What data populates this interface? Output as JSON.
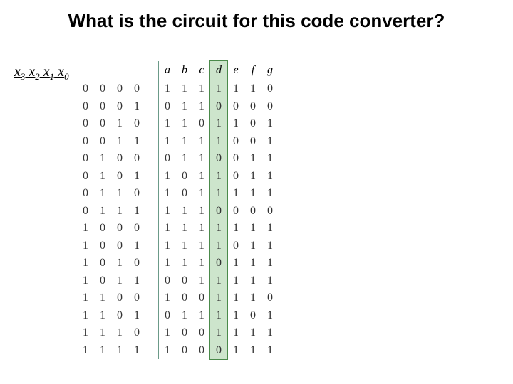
{
  "title": "What is the circuit for this code converter?",
  "input_vars": [
    "x",
    "3",
    "x",
    "2",
    "x",
    "1",
    "x",
    "0"
  ],
  "headers": {
    "inputs": [
      "",
      "",
      "",
      ""
    ],
    "outputs": [
      "a",
      "b",
      "c",
      "d",
      "e",
      "f",
      "g"
    ]
  },
  "highlight_column": "d",
  "chart_data": {
    "type": "table",
    "title": "4-bit input to 7-segment (a–g) code converter truth table",
    "input_labels": [
      "x3",
      "x2",
      "x1",
      "x0"
    ],
    "output_labels": [
      "a",
      "b",
      "c",
      "d",
      "e",
      "f",
      "g"
    ],
    "rows": [
      {
        "in": [
          0,
          0,
          0,
          0
        ],
        "out": [
          1,
          1,
          1,
          1,
          1,
          1,
          0
        ]
      },
      {
        "in": [
          0,
          0,
          0,
          1
        ],
        "out": [
          0,
          1,
          1,
          0,
          0,
          0,
          0
        ]
      },
      {
        "in": [
          0,
          0,
          1,
          0
        ],
        "out": [
          1,
          1,
          0,
          1,
          1,
          0,
          1
        ]
      },
      {
        "in": [
          0,
          0,
          1,
          1
        ],
        "out": [
          1,
          1,
          1,
          1,
          0,
          0,
          1
        ]
      },
      {
        "in": [
          0,
          1,
          0,
          0
        ],
        "out": [
          0,
          1,
          1,
          0,
          0,
          1,
          1
        ]
      },
      {
        "in": [
          0,
          1,
          0,
          1
        ],
        "out": [
          1,
          0,
          1,
          1,
          0,
          1,
          1
        ]
      },
      {
        "in": [
          0,
          1,
          1,
          0
        ],
        "out": [
          1,
          0,
          1,
          1,
          1,
          1,
          1
        ]
      },
      {
        "in": [
          0,
          1,
          1,
          1
        ],
        "out": [
          1,
          1,
          1,
          0,
          0,
          0,
          0
        ]
      },
      {
        "in": [
          1,
          0,
          0,
          0
        ],
        "out": [
          1,
          1,
          1,
          1,
          1,
          1,
          1
        ]
      },
      {
        "in": [
          1,
          0,
          0,
          1
        ],
        "out": [
          1,
          1,
          1,
          1,
          0,
          1,
          1
        ]
      },
      {
        "in": [
          1,
          0,
          1,
          0
        ],
        "out": [
          1,
          1,
          1,
          0,
          1,
          1,
          1
        ]
      },
      {
        "in": [
          1,
          0,
          1,
          1
        ],
        "out": [
          0,
          0,
          1,
          1,
          1,
          1,
          1
        ]
      },
      {
        "in": [
          1,
          1,
          0,
          0
        ],
        "out": [
          1,
          0,
          0,
          1,
          1,
          1,
          0
        ]
      },
      {
        "in": [
          1,
          1,
          0,
          1
        ],
        "out": [
          0,
          1,
          1,
          1,
          1,
          0,
          1
        ]
      },
      {
        "in": [
          1,
          1,
          1,
          0
        ],
        "out": [
          1,
          0,
          0,
          1,
          1,
          1,
          1
        ]
      },
      {
        "in": [
          1,
          1,
          1,
          1
        ],
        "out": [
          1,
          0,
          0,
          0,
          1,
          1,
          1
        ]
      }
    ]
  }
}
